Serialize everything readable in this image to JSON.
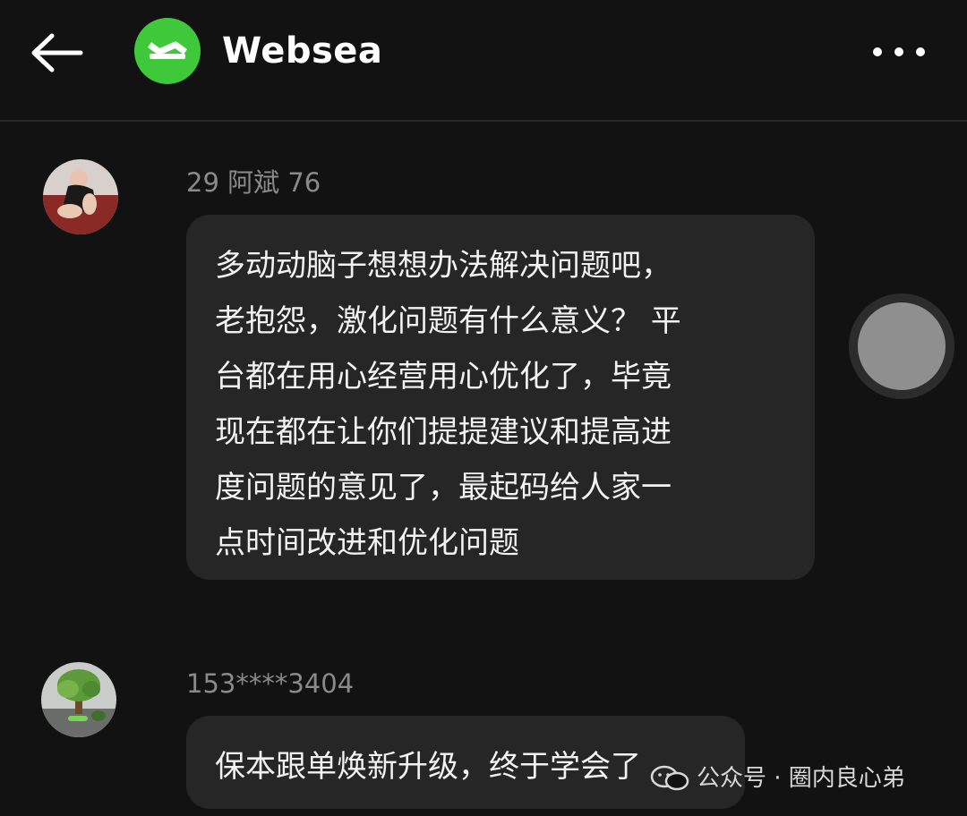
{
  "header": {
    "title": "Websea"
  },
  "icons": {
    "back": "arrow-left-icon",
    "logo": "websea-logo-icon",
    "more": "more-horizontal-icon",
    "wechat": "wechat-icon"
  },
  "colors": {
    "background": "#121212",
    "bubble": "#262626",
    "username": "#8a8a8a",
    "brand_green": "#3ec83a"
  },
  "comments": [
    {
      "username": "29 阿斌 76",
      "lines": [
        "多动动脑子想想办法解决问题吧，",
        "老抱怨，激化问题有什么意义？ 平",
        "台都在用心经营用心优化了，毕竟",
        "现在都在让你们提提建议和提高进",
        "度问题的意见了，最起码给人家一",
        "点时间改进和优化问题"
      ]
    },
    {
      "username": "153****3404",
      "lines": [
        "保本跟单焕新升级，终于学会了"
      ]
    }
  ],
  "watermark": {
    "text": "公众号 · 圈内良心弟"
  }
}
